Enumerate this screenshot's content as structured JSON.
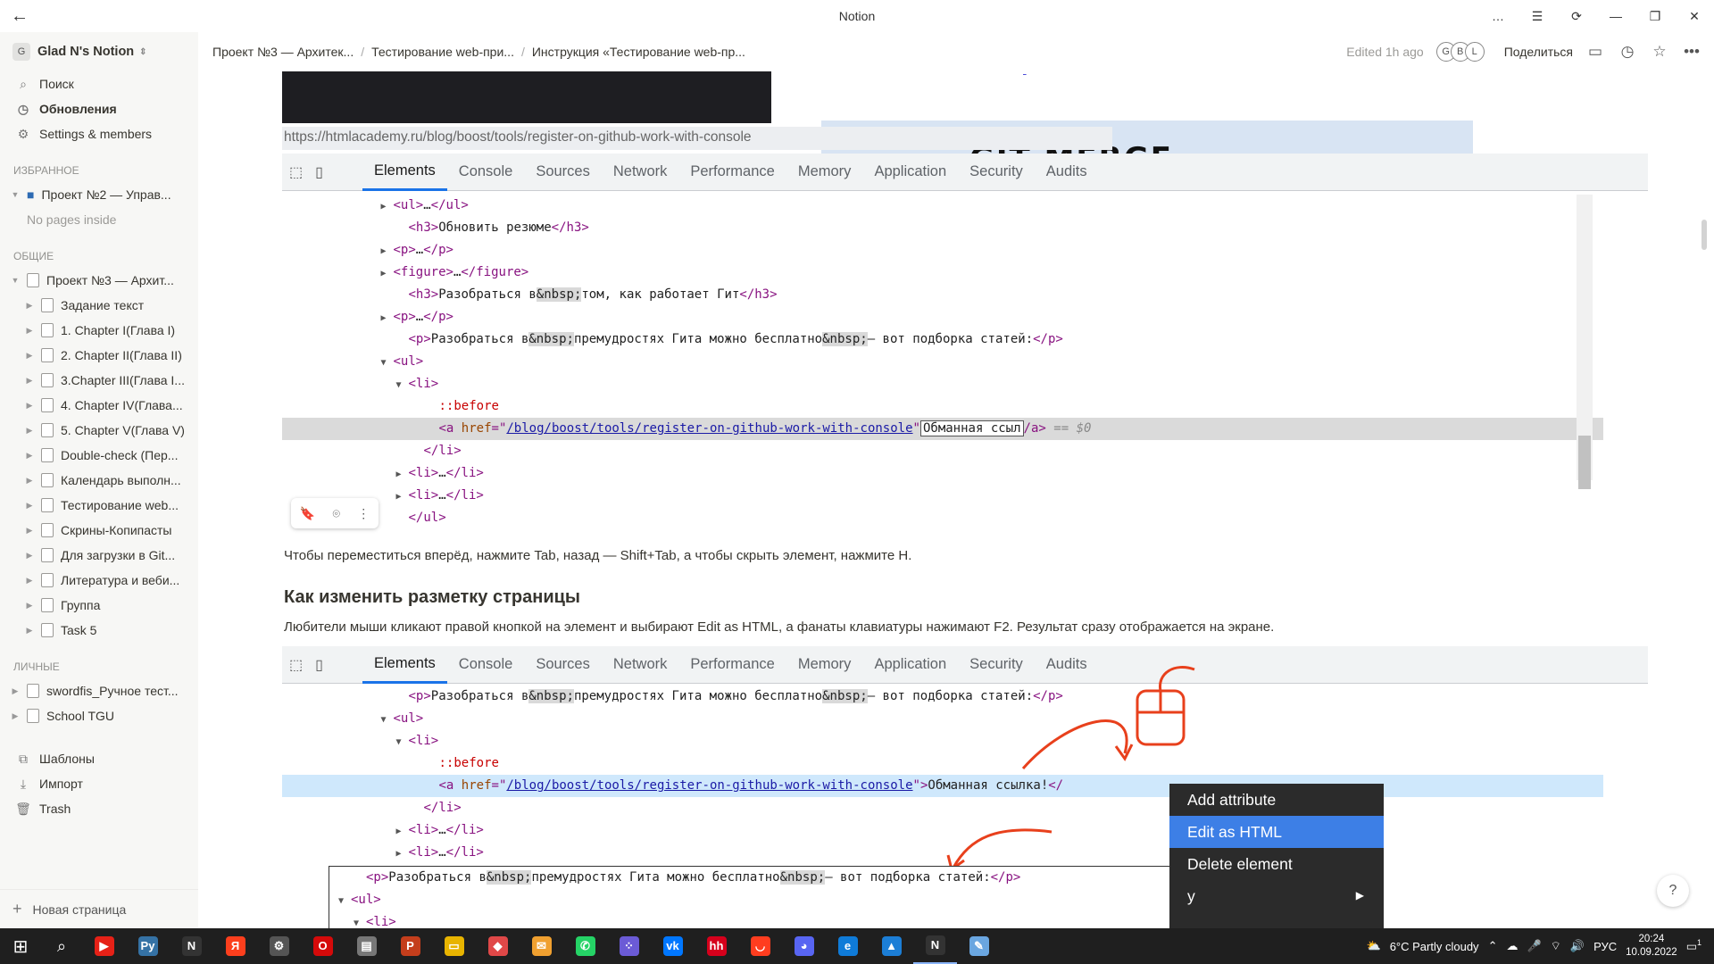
{
  "window": {
    "title": "Notion"
  },
  "sidebar": {
    "workspace": "Glad N's Notion",
    "workspace_badge": "G",
    "nav": [
      {
        "label": "Поиск",
        "icon": "search-icon"
      },
      {
        "label": "Обновления",
        "icon": "clock-icon"
      },
      {
        "label": "Settings & members",
        "icon": "gear-icon"
      }
    ],
    "favorites_title": "ИЗБРАННОЕ",
    "favorites": [
      {
        "label": "Проект №2 — Управ...",
        "empty_note": "No pages inside"
      }
    ],
    "shared_title": "ОБЩИЕ",
    "shared_root": "Проект №3 — Архит...",
    "shared_pages": [
      "Задание текст",
      "1. Chapter I(Глава I)",
      "2. Chapter II(Глава II)",
      "3.Chapter III(Глава I...",
      "4. Chapter IV(Глава...",
      "5. Chapter V(Глава V)",
      "Double-check (Пер...",
      "Календарь выполн...",
      "Тестирование web...",
      "Скрины-Копипасты",
      "Для загрузки в Git...",
      "Литература и веби...",
      "Группа",
      "Task 5"
    ],
    "private_title": "ЛИЧНЫЕ",
    "private_pages": [
      "swordfis_Ручное тест...",
      "School TGU"
    ],
    "bottom": [
      {
        "label": "Шаблоны",
        "icon": "templates-icon"
      },
      {
        "label": "Импорт",
        "icon": "import-icon"
      },
      {
        "label": "Trash",
        "icon": "trash-icon"
      }
    ],
    "new_page": "Новая страница"
  },
  "topbar": {
    "breadcrumbs": [
      "Проект №3 — Архитек...",
      "Тестирование web-при...",
      "Инструкция «Тестирование web-пр..."
    ],
    "edited": "Edited 1h ago",
    "avatars": [
      "G",
      "B",
      "L"
    ],
    "share": "Поделиться"
  },
  "shot1": {
    "url": "https://htmlacademy.ru/blog/boost/tools/register-on-github-work-with-console",
    "banner": "GIT MERGE",
    "tabs": [
      "Elements",
      "Console",
      "Sources",
      "Network",
      "Performance",
      "Memory",
      "Application",
      "Security",
      "Audits"
    ],
    "lines": [
      {
        "indent": 13,
        "tri": "▶",
        "html": "<span class='tg'>&lt;ul&gt;</span>…<span class='tg'>&lt;/ul&gt;</span>"
      },
      {
        "indent": 15,
        "tri": "",
        "html": "<span class='tg'>&lt;h3&gt;</span>Обновить резюме<span class='tg'>&lt;/h3&gt;</span>"
      },
      {
        "indent": 13,
        "tri": "▶",
        "html": "<span class='tg'>&lt;p&gt;</span>…<span class='tg'>&lt;/p&gt;</span>"
      },
      {
        "indent": 13,
        "tri": "▶",
        "html": "<span class='tg'>&lt;figure&gt;</span>…<span class='tg'>&lt;/figure&gt;</span>"
      },
      {
        "indent": 15,
        "tri": "",
        "html": "<span class='tg'>&lt;h3&gt;</span>Разобраться в<span class='ent'>&amp;nbsp;</span>том, как работает Гит<span class='tg'>&lt;/h3&gt;</span>"
      },
      {
        "indent": 13,
        "tri": "▶",
        "html": "<span class='tg'>&lt;p&gt;</span>…<span class='tg'>&lt;/p&gt;</span>"
      },
      {
        "indent": 15,
        "tri": "",
        "html": "<span class='tg'>&lt;p&gt;</span>Разобраться в<span class='ent'>&amp;nbsp;</span>премудростях Гита можно бесплатно<span class='ent'>&amp;nbsp;</span>— вот подборка статей:<span class='tg'>&lt;/p&gt;</span>"
      },
      {
        "indent": 13,
        "tri": "▼",
        "html": "<span class='tg'>&lt;ul&gt;</span>"
      },
      {
        "indent": 15,
        "tri": "▼",
        "html": "<span class='tg'>&lt;li&gt;</span>"
      },
      {
        "indent": 19,
        "tri": "",
        "html": "<span class='pe'>::before</span>"
      },
      {
        "indent": 19,
        "tri": "",
        "sel": true,
        "html": "<span class='tg'>&lt;a </span><span class='at'>href</span><span class='tg'>=\"</span><span class='av2'>/blog/boost/tools/register-on-github-work-with-console</span><span class='tg'>\"</span><span class='editbox'>Обманная ссыл</span><span class='tg'>/a&gt;</span> <span class='d0'>== $0</span>"
      },
      {
        "indent": 17,
        "tri": "",
        "html": "<span class='tg'>&lt;/li&gt;</span>"
      },
      {
        "indent": 15,
        "tri": "▶",
        "html": "<span class='tg'>&lt;li&gt;</span>…<span class='tg'>&lt;/li&gt;</span>"
      },
      {
        "indent": 15,
        "tri": "▶",
        "html": "<span class='tg'>&lt;li&gt;</span>…<span class='tg'>&lt;/li&gt;</span>"
      },
      {
        "indent": 15,
        "tri": "",
        "html": "<span class='tg'>&lt;/ul&gt;</span>"
      }
    ]
  },
  "para1": "Чтобы переместиться вперёд, нажмите Tab, назад — Shift+Tab, а чтобы скрыть элемент, нажмите H.",
  "heading": "Как изменить разметку страницы",
  "para2": "Любители мыши кликают правой кнопкой на элемент и выбирают Edit as HTML, а фанаты клавиатуры нажимают F2. Результат сразу отображается на экране.",
  "shot2": {
    "tabs": [
      "Elements",
      "Console",
      "Sources",
      "Network",
      "Performance",
      "Memory",
      "Application",
      "Security",
      "Audits"
    ],
    "lines": [
      {
        "indent": 15,
        "tri": "",
        "html": "<span class='tg'>&lt;p&gt;</span>Разобраться в<span class='ent'>&amp;nbsp;</span>премудростях Гита можно бесплатно<span class='ent'>&amp;nbsp;</span>— вот подборка статей:<span class='tg'>&lt;/p&gt;</span>"
      },
      {
        "indent": 13,
        "tri": "▼",
        "html": "<span class='tg'>&lt;ul&gt;</span>"
      },
      {
        "indent": 15,
        "tri": "▼",
        "html": "<span class='tg'>&lt;li&gt;</span>"
      },
      {
        "indent": 19,
        "tri": "",
        "html": "<span class='pe'>::before</span>"
      },
      {
        "indent": 19,
        "tri": "",
        "sel": true,
        "html": "<span class='tg'>&lt;a </span><span class='at'>href</span><span class='tg'>=\"</span><span class='av2'>/blog/boost/tools/register-on-github-work-with-console</span><span class='tg'>\"&gt;</span>Обманная ссылка!<span class='tg'>&lt;/</span>"
      },
      {
        "indent": 17,
        "tri": "",
        "html": "<span class='tg'>&lt;/li&gt;</span>"
      },
      {
        "indent": 15,
        "tri": "▶",
        "html": "<span class='tg'>&lt;li&gt;</span>…<span class='tg'>&lt;/li&gt;</span>"
      },
      {
        "indent": 15,
        "tri": "▶",
        "html": "<span class='tg'>&lt;li&gt;</span>…<span class='tg'>&lt;/li&gt;</span>"
      }
    ],
    "context_menu": [
      "Add attribute",
      "Edit as HTML",
      "Delete element",
      "y"
    ],
    "context_menu_selected": "Edit as HTML",
    "inner_lines": [
      {
        "indent": 2,
        "tri": "",
        "html": "<span class='tg'>&lt;p&gt;</span>Разобраться в<span class='ent'>&amp;nbsp;</span>премудростях Гита можно бесплатно<span class='ent'>&amp;nbsp;</span>— вот подборка статей:<span class='tg'>&lt;/p&gt;</span>"
      },
      {
        "indent": 0,
        "tri": "▼",
        "html": "<span class='tg'>&lt;ul&gt;</span>"
      },
      {
        "indent": 2,
        "tri": "▼",
        "html": "<span class='tg'>&lt;li&gt;</span>"
      }
    ]
  },
  "taskbar": {
    "weather": "6°C  Partly cloudy",
    "lang": "РУС",
    "time": "20:24",
    "date": "10.09.2022",
    "notif_count": "1",
    "apps": [
      {
        "name": "youtube-icon",
        "color": "#e62117",
        "glyph": "▶"
      },
      {
        "name": "python-icon",
        "color": "#3572a5",
        "glyph": "Py"
      },
      {
        "name": "notion-icon",
        "color": "#333333",
        "glyph": "N"
      },
      {
        "name": "yandex-icon",
        "color": "#fc3f1d",
        "glyph": "Я"
      },
      {
        "name": "settings-icon",
        "color": "#555555",
        "glyph": "⚙"
      },
      {
        "name": "opera-icon",
        "color": "#d50a0a",
        "glyph": "O"
      },
      {
        "name": "files-icon",
        "color": "#777777",
        "glyph": "▤"
      },
      {
        "name": "powerpoint-icon",
        "color": "#c43e1c",
        "glyph": "P"
      },
      {
        "name": "explorer-icon",
        "color": "#e8b400",
        "glyph": "▭"
      },
      {
        "name": "app-red-icon",
        "color": "#e04848",
        "glyph": "◆"
      },
      {
        "name": "mail-icon",
        "color": "#f0a030",
        "glyph": "✉"
      },
      {
        "name": "whatsapp-icon",
        "color": "#25d366",
        "glyph": "✆"
      },
      {
        "name": "dots-app-icon",
        "color": "#6b5bd6",
        "glyph": "⁘"
      },
      {
        "name": "vk-icon",
        "color": "#0077ff",
        "glyph": "vk"
      },
      {
        "name": "hh-icon",
        "color": "#d6001c",
        "glyph": "hh"
      },
      {
        "name": "shop-icon",
        "color": "#ff3d1f",
        "glyph": "◡"
      },
      {
        "name": "discord-icon",
        "color": "#5865f2",
        "glyph": "◕"
      },
      {
        "name": "edge-icon",
        "color": "#0f7bd8",
        "glyph": "e"
      },
      {
        "name": "photos-icon",
        "color": "#1c7ed6",
        "glyph": "▲"
      },
      {
        "name": "notion-active-icon",
        "color": "#333333",
        "glyph": "N",
        "active": true
      },
      {
        "name": "notepad-icon",
        "color": "#6aa6e0",
        "glyph": "✎"
      }
    ]
  }
}
